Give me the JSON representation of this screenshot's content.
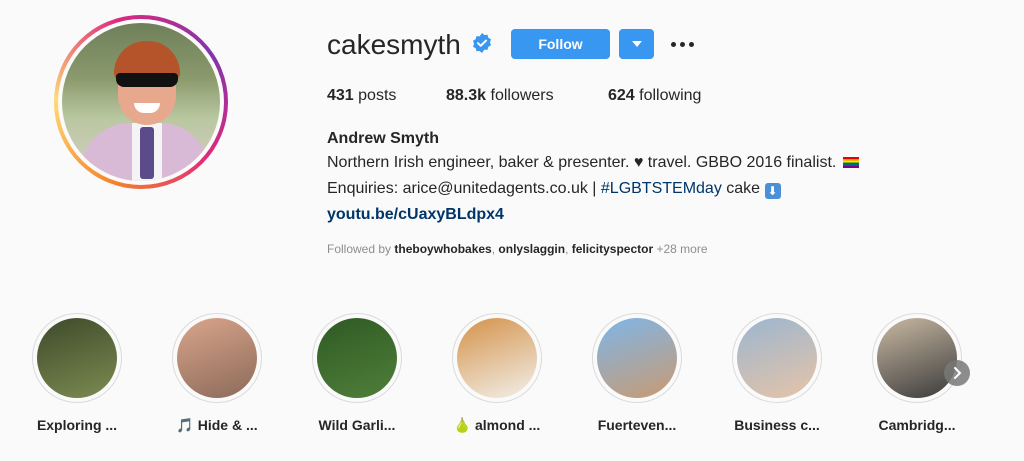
{
  "profile": {
    "username": "cakesmyth",
    "follow_label": "Follow",
    "stats": {
      "posts_count": "431",
      "posts_label": "posts",
      "followers_count": "88.3k",
      "followers_label": "followers",
      "following_count": "624",
      "following_label": "following"
    },
    "full_name": "Andrew Smyth",
    "bio_line1_a": "Northern Irish engineer, baker & presenter.",
    "bio_line1_b": "travel. GBBO 2016 finalist.",
    "bio_line2_a": "Enquiries: arice@unitedagents.co.uk |",
    "bio_line2_hashtag": "#LGBTSTEMday",
    "bio_line2_b": "cake",
    "link": "youtu.be/cUaxyBLdpx4",
    "followed_by_prefix": "Followed by",
    "followed_by_users": [
      "theboywhobakes",
      "onlyslaggin",
      "felicityspector"
    ],
    "followed_by_more": "+28 more"
  },
  "highlights": [
    {
      "label": "Exploring ...",
      "colors": [
        "#3d4a2a",
        "#7d8b52"
      ]
    },
    {
      "label": "🎵 Hide & ...",
      "colors": [
        "#d9a58a",
        "#8b6a5a"
      ]
    },
    {
      "label": "Wild Garli...",
      "colors": [
        "#2f5a24",
        "#4f7f3a"
      ]
    },
    {
      "label": "🍐 almond ...",
      "colors": [
        "#d4924a",
        "#f2f0ea"
      ]
    },
    {
      "label": "Fuerteven...",
      "colors": [
        "#7fb6e8",
        "#c89a72"
      ]
    },
    {
      "label": "Business c...",
      "colors": [
        "#9bb6cf",
        "#e6c4a8"
      ]
    },
    {
      "label": "Cambridg...",
      "colors": [
        "#c9b9a3",
        "#3a3a3a"
      ]
    }
  ],
  "colors": {
    "accent": "#3897f0",
    "verified": "#3897f0",
    "link": "#003569"
  }
}
